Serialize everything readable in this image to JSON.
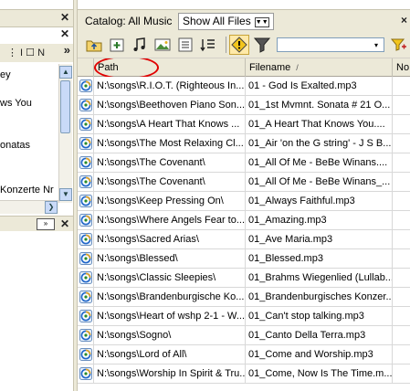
{
  "left_pane": {
    "toolbar_label": "⋮ I  ☐ N",
    "toolbar_chevron": "»",
    "items": [
      "ey",
      "ws You",
      "onatas",
      "Konzerte Nr"
    ],
    "hscroll_right": "❯",
    "bottom_arrow": "»"
  },
  "catalog": {
    "tab_label": "Catalog: All Music",
    "show_all_files_label": "Show All Files",
    "close_label": "×"
  },
  "toolbar": {
    "filter_value": "",
    "dropdown_glyph": "▾"
  },
  "grid": {
    "columns": [
      "",
      "Path",
      "Filename",
      "No"
    ],
    "sort_indicator": "/",
    "rows": [
      {
        "path": "N:\\songs\\R.I.O.T. (Righteous In...",
        "filename": "01 - God Is Exalted.mp3"
      },
      {
        "path": "N:\\songs\\Beethoven Piano Son...",
        "filename": "01_1st Mvmnt. Sonata # 21 O..."
      },
      {
        "path": "N:\\songs\\A Heart That Knows ...",
        "filename": "01_A Heart That Knows You...."
      },
      {
        "path": "N:\\songs\\The Most Relaxing Cl...",
        "filename": "01_Air 'on the G string' - J S B..."
      },
      {
        "path": "N:\\songs\\The Covenant\\",
        "filename": "01_All Of Me - BeBe Winans...."
      },
      {
        "path": "N:\\songs\\The Covenant\\",
        "filename": "01_All Of Me - BeBe Winans_..."
      },
      {
        "path": "N:\\songs\\Keep Pressing On\\",
        "filename": "01_Always Faithful.mp3"
      },
      {
        "path": "N:\\songs\\Where Angels Fear to...",
        "filename": "01_Amazing.mp3"
      },
      {
        "path": "N:\\songs\\Sacred Arias\\",
        "filename": "01_Ave Maria.mp3"
      },
      {
        "path": "N:\\songs\\Blessed\\",
        "filename": "01_Blessed.mp3"
      },
      {
        "path": "N:\\songs\\Classic Sleepies\\",
        "filename": "01_Brahms Wiegenlied (Lullab..."
      },
      {
        "path": "N:\\songs\\Brandenburgische Ko...",
        "filename": "01_Brandenburgisches Konzer..."
      },
      {
        "path": "N:\\songs\\Heart of wshp 2-1 - W...",
        "filename": "01_Can't stop talking.mp3"
      },
      {
        "path": "N:\\songs\\Sogno\\",
        "filename": "01_Canto Della Terra.mp3"
      },
      {
        "path": "N:\\songs\\Lord of All\\",
        "filename": "01_Come and Worship.mp3"
      },
      {
        "path": "N:\\songs\\Worship In Spirit & Tru...",
        "filename": "01_Come, Now Is The Time.m..."
      }
    ]
  },
  "colors": {
    "highlight": "#e00000",
    "chrome": "#ece9d8"
  }
}
